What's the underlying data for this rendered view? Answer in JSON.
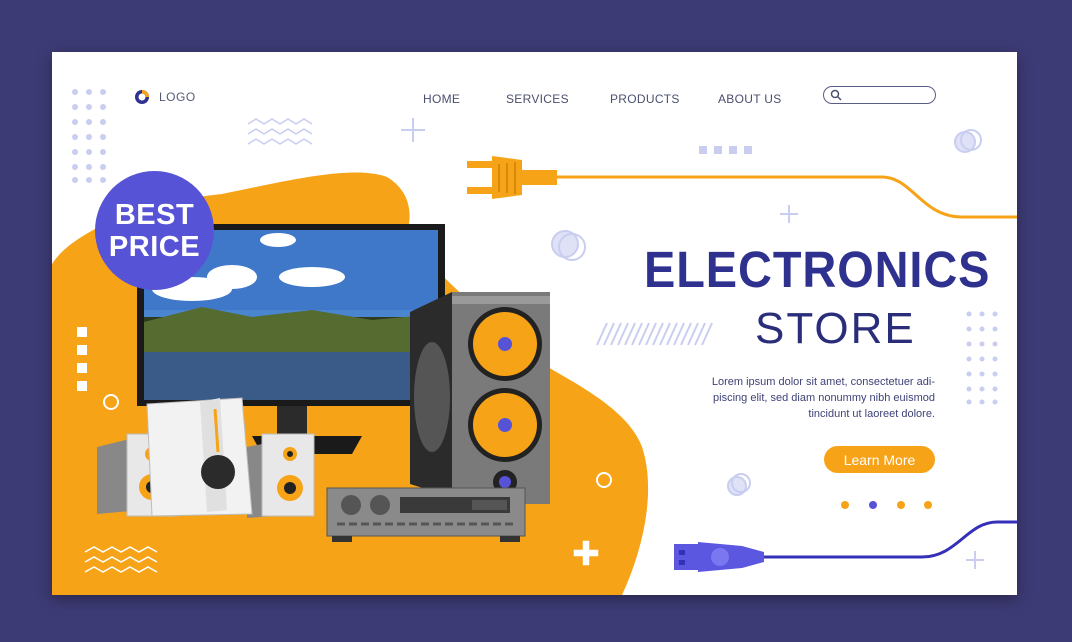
{
  "brand": {
    "logo_label": "LOGO"
  },
  "nav": {
    "items": [
      {
        "label": "HOME"
      },
      {
        "label": "SERVICES"
      },
      {
        "label": "PRODUCTS"
      },
      {
        "label": "ABOUT US"
      }
    ]
  },
  "search": {
    "placeholder": "",
    "value": ""
  },
  "badge": {
    "line1": "BEST",
    "line2": "PRICE"
  },
  "hero": {
    "title_line1": "ELECTRONICS",
    "title_line2": "STORE",
    "description_lines": [
      "Lorem ipsum dolor sit amet, consectetuer adi-",
      "piscing elit, sed diam nonummy nibh euismod",
      "tincidunt ut laoreet dolore."
    ],
    "cta_label": "Learn More"
  },
  "colors": {
    "background": "#3d3b75",
    "accent_orange": "#f7a318",
    "accent_blue": "#2f318f",
    "badge_purple": "#5753d6"
  },
  "icons": [
    "logo-icon",
    "search-icon",
    "plug-icon",
    "usb-plug-icon",
    "plus-icon"
  ]
}
